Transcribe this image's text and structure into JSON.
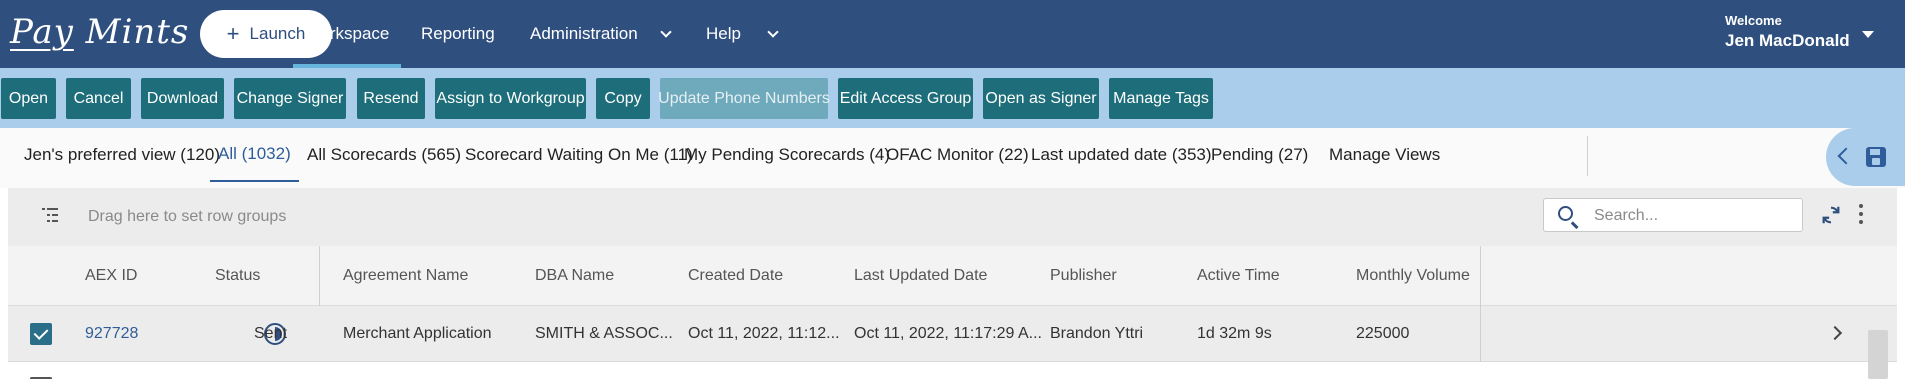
{
  "app": {
    "logo_left": "Pay",
    "logo_right": "Mints",
    "launch_label": "Launch"
  },
  "nav": {
    "workspace": "Workspace",
    "reporting": "Reporting",
    "administration": "Administration",
    "help": "Help"
  },
  "user": {
    "welcome": "Welcome",
    "name": "Jen MacDonald"
  },
  "actions": {
    "open": "Open",
    "cancel": "Cancel",
    "download": "Download",
    "change_signer": "Change Signer",
    "resend": "Resend",
    "assign_workgroup": "Assign to Workgroup",
    "copy": "Copy",
    "update_phone": "Update Phone Numbers",
    "edit_access": "Edit Access Group",
    "open_as_signer": "Open as Signer",
    "manage_tags": "Manage Tags"
  },
  "views": {
    "preferred": "Jen's preferred view (120)",
    "all": "All (1032)",
    "all_scorecards": "All Scorecards (565)",
    "scorecard_waiting": "Scorecard Waiting On Me (11)",
    "my_pending": "My Pending Scorecards (4)",
    "ofac": "OFAC Monitor (22)",
    "last_updated": "Last updated date (353)",
    "pending": "Pending (27)",
    "manage": "Manage Views"
  },
  "grid": {
    "group_placeholder": "Drag here to set row groups",
    "search_placeholder": "Search...",
    "columns": {
      "aex_id": "AEX ID",
      "status": "Status",
      "agreement": "Agreement Name",
      "dba": "DBA Name",
      "created": "Created Date",
      "updated": "Last Updated Date",
      "publisher": "Publisher",
      "active": "Active Time",
      "volume": "Monthly Volume"
    },
    "rows": [
      {
        "selected": true,
        "aex_id": "927728",
        "status": "Sent",
        "agreement": "Merchant Application",
        "dba": "SMITH & ASSOC...",
        "created": "Oct 11, 2022, 11:12...",
        "updated": "Oct 11, 2022, 11:17:29 A...",
        "publisher": "Brandon Yttri",
        "active": "1d 32m 9s",
        "volume": "225000"
      }
    ]
  },
  "colors": {
    "nav_bg": "#2f4f7f",
    "toolbar_bg": "#a9cdea",
    "button_bg": "#1d6e7a",
    "button_disabled_bg": "#6fa9bc",
    "accent": "#2f5d9a",
    "active_tab_underline": "#66b5dc"
  },
  "icons": [
    "plus-icon",
    "chevron-down-icon",
    "caret-down-icon",
    "chevron-left-icon",
    "save-icon",
    "row-group-icon",
    "search-icon",
    "refresh-icon",
    "more-vertical-icon",
    "half-circle-status-icon",
    "chevron-right-icon",
    "checkbox-checked-icon"
  ]
}
